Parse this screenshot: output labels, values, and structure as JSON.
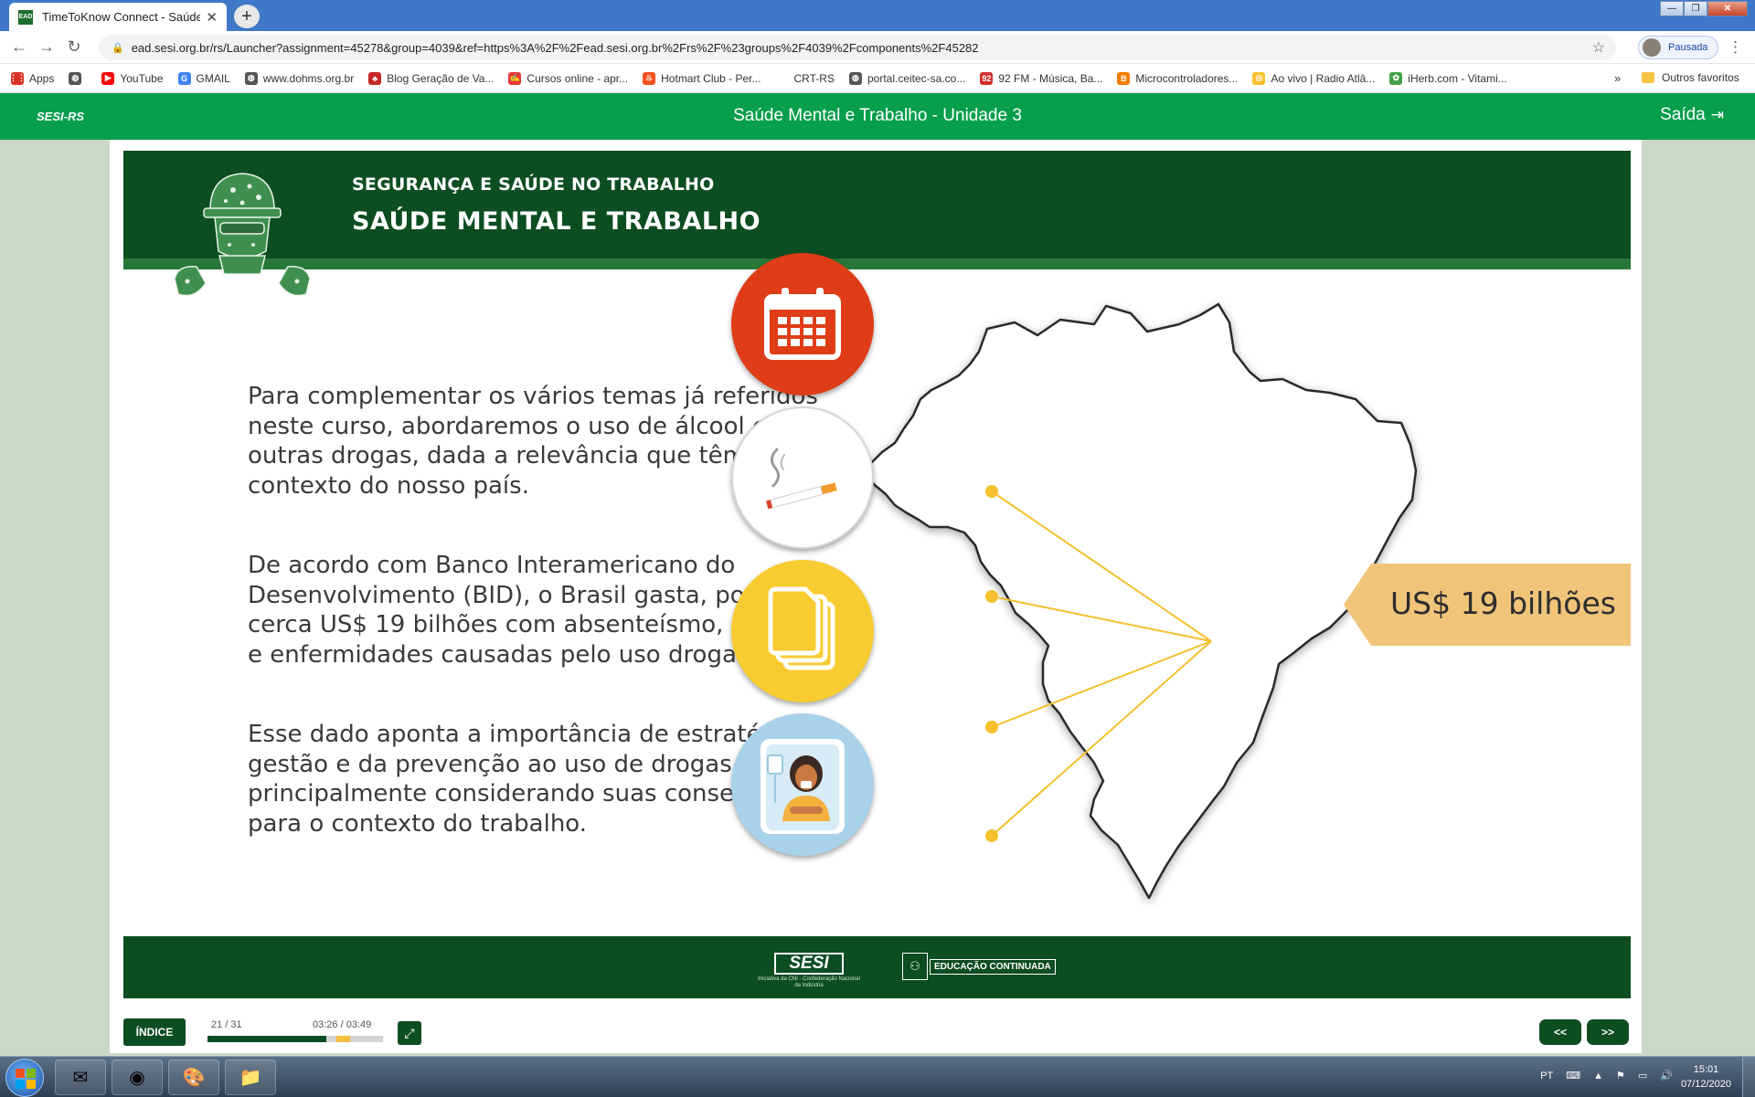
{
  "browser": {
    "tab_title": "TimeToKnow Connect - Saúde M",
    "tab_favicon_text": "EAD",
    "new_tab_label": "+",
    "url": "ead.sesi.org.br/rs/Launcher?assignment=45278&group=4039&ref=https%3A%2F%2Fead.sesi.org.br%2Frs%2F%23groups%2F4039%2Fcomponents%2F45282",
    "profile_label": "Pausada",
    "bookmarks": [
      {
        "label": "Apps",
        "icon": "apps-grid-icon",
        "color": "#d93025"
      },
      {
        "label": "",
        "icon": "globe-icon",
        "color": "#555555"
      },
      {
        "label": "YouTube",
        "icon": "youtube-icon",
        "color": "#ff0000"
      },
      {
        "label": "GMAIL",
        "icon": "google-icon",
        "color": "#4285f4"
      },
      {
        "label": "www.dohms.org.br",
        "icon": "globe-icon",
        "color": "#555555"
      },
      {
        "label": "Blog Geração de Va...",
        "icon": "blog-icon",
        "color": "#c62828"
      },
      {
        "label": "Cursos online - apr...",
        "icon": "cursos-icon",
        "color": "#e53935"
      },
      {
        "label": "Hotmart Club - Per...",
        "icon": "hotmart-icon",
        "color": "#f4511e"
      },
      {
        "label": "CRT-RS",
        "icon": "blank-icon",
        "color": "#ffffff"
      },
      {
        "label": "portal.ceitec-sa.co...",
        "icon": "globe-icon",
        "color": "#555555"
      },
      {
        "label": "92 FM - Música, Ba...",
        "icon": "radio-92-icon",
        "color": "#d32f2f"
      },
      {
        "label": "Microcontroladores...",
        "icon": "blogger-icon",
        "color": "#f57c00"
      },
      {
        "label": "Ao vivo | Radio Atlâ...",
        "icon": "radio-icon",
        "color": "#fbc02d"
      },
      {
        "label": "iHerb.com - Vitami...",
        "icon": "iherb-icon",
        "color": "#43a047"
      }
    ],
    "bookmarks_more": "»",
    "other_bookmarks": "Outros favoritos"
  },
  "player": {
    "brand": "SESI-RS",
    "course_title": "Saúde Mental e Trabalho - Unidade 3",
    "exit_label": "Saída",
    "index_label": "ÍNDICE",
    "slide_counter": "21 / 31",
    "time_counter": "03:26 / 03:49",
    "progress_fraction": 0.677,
    "prev_label": "<<",
    "next_label": ">>"
  },
  "slide": {
    "kicker": "SEGURANÇA E SAÚDE NO TRABALHO",
    "title": "SAÚDE MENTAL E TRABALHO",
    "paragraphs": [
      "Para complementar os vários temas já referidos neste curso, abordaremos o uso de álcool e de outras drogas, dada a relevância que têm para o contexto do nosso país.",
      "De acordo com Banco Interamericano do Desenvolvimento (BID), o Brasil gasta, por ano, cerca US$ 19 bilhões com absenteísmo, acidentes e enfermidades causadas pelo uso drogas.",
      "Esse dado aponta a importância de estratégias da gestão e da prevenção ao uso de drogas, principalmente considerando suas consequências para o contexto do trabalho."
    ],
    "cost_label": "US$ 19 bilhões",
    "icons": [
      "calendar-icon",
      "cigarette-icon",
      "documents-icon",
      "hospital-patient-icon"
    ],
    "colors": {
      "header_green": "#0d4d22",
      "player_green": "#079e4c",
      "red_circle": "#de3d17",
      "yellow_circle": "#f8cc30",
      "blue_circle": "#a8d1ea",
      "connector": "#f4c02d",
      "label_bg": "#f0c57a"
    },
    "footer": {
      "sesi_logo": "SESI",
      "sesi_sub": "Iniciativa da CNI - Confederação Nacional da Indústria",
      "edu_logo": "EDUCAÇÃO CONTINUADA"
    }
  },
  "taskbar": {
    "language": "PT",
    "time": "15:01",
    "date": "07/12/2020",
    "apps": [
      "outlook-icon",
      "chrome-icon",
      "paint-icon",
      "file-explorer-icon"
    ]
  }
}
